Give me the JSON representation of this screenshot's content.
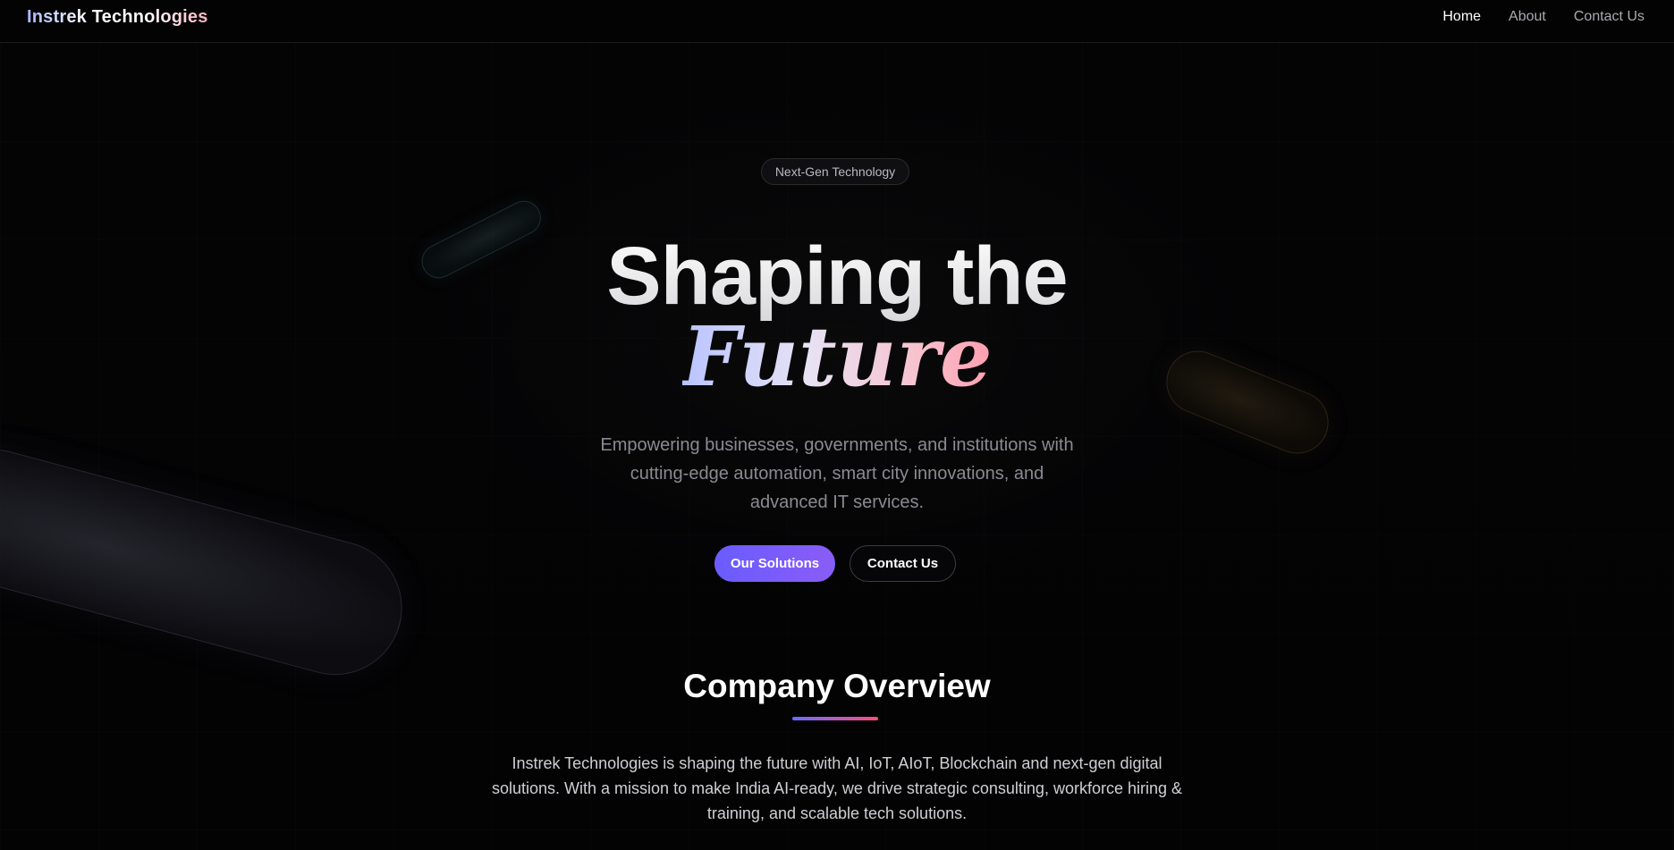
{
  "header": {
    "brand": "Instrek Technologies",
    "nav": [
      {
        "label": "Home",
        "active": true
      },
      {
        "label": "About",
        "active": false
      },
      {
        "label": "Contact Us",
        "active": false
      }
    ]
  },
  "hero": {
    "badge": "Next-Gen Technology",
    "title_line1": "Shaping the",
    "title_line2": "Future",
    "subtitle": "Empowering businesses, governments, and institutions with cutting-edge automation, smart city innovations, and advanced IT services.",
    "primary_button": "Our Solutions",
    "secondary_button": "Contact Us"
  },
  "overview": {
    "title": "Company Overview",
    "text": "Instrek Technologies is shaping the future with AI, IoT, AIoT, Blockchain and next-gen digital solutions. With a mission to make India AI-ready, we drive strategic consulting, workforce hiring & training, and scalable tech solutions."
  },
  "colors": {
    "background": "#030304",
    "accent_primary": "#6a5cff",
    "accent_secondary": "#ff4d7d"
  }
}
